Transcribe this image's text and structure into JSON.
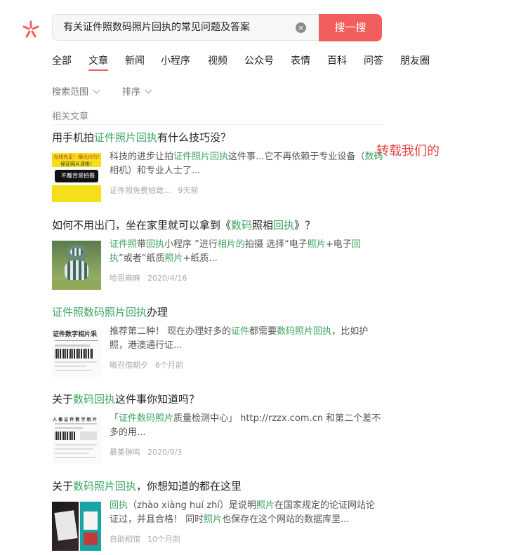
{
  "search": {
    "query": "有关证件照数码照片回执的常见问题及答案",
    "button_label": "搜一搜"
  },
  "tabs": [
    {
      "label": "全部"
    },
    {
      "label": "文章",
      "active": true
    },
    {
      "label": "新闻"
    },
    {
      "label": "小程序"
    },
    {
      "label": "视频"
    },
    {
      "label": "公众号"
    },
    {
      "label": "表情"
    },
    {
      "label": "百科"
    },
    {
      "label": "问答"
    },
    {
      "label": "朋友圈"
    }
  ],
  "filters": {
    "range_label": "搜索范围",
    "sort_label": "排序"
  },
  "section_label": "相关文章",
  "watermark": "转载我们的",
  "results": [
    {
      "title": [
        "用手机拍",
        "证件照片回执",
        "有什么技巧没？"
      ],
      "snippet": [
        "科技的进步让拍",
        "证件照片回执",
        "这件事...它不再依赖于专业设备（",
        "数码",
        "相机）和专业人士了..."
      ],
      "source": "证件照免费拍敢...",
      "time": "9天前",
      "thumb_text_1": "光线充足！横光均匀！",
      "thumb_text_2": "保证照片清晰！",
      "thumb_text_3": "不戴背景拍摄"
    },
    {
      "title": [
        "如何不用出门，坐在家里就可以拿到《",
        "数码",
        "照相",
        "回执",
        "》？"
      ],
      "snippet": [
        "证件照",
        "带",
        "回执",
        "小程序 ”进行",
        "相片的",
        "拍摄 选择“电子",
        "照片",
        "+电子",
        "回执",
        "”或者“纸质",
        "照片",
        "+纸质..."
      ],
      "source": "哈哥麻麻",
      "time": "2020/4/16"
    },
    {
      "title": [
        "证件照数码照片回执",
        "办理"
      ],
      "snippet": [
        "推荐第二种！ 现在办理好多的",
        "证件",
        "都需要",
        "数码照片回执",
        "，比如护照，港澳通行证..."
      ],
      "source": "曦召借朝夕",
      "time": "6个月前",
      "thumb_text_1": "证件数字相片采"
    },
    {
      "title": [
        "关于",
        "数码回执",
        "这件事你知道吗？"
      ],
      "snippet": [
        "「",
        "证件数码照片",
        "质量检测中心」 http://rzzx.com.cn 和第二个差不多的用..."
      ],
      "source": "最美翀鸣",
      "time": "2020/9/3",
      "thumb_text_1": "人 像 证 件 数 字 相 片"
    },
    {
      "title": [
        "关于",
        "数码照片回执",
        "，你想知道的都在这里"
      ],
      "snippet": [
        "回执",
        "（zhào xiàng huí zhí）是说明",
        "照片",
        "在国家规定的论证网站论证过，并且合格！ 同时",
        "照片",
        "也保存在这个网站的数据库里..."
      ],
      "source": "自助相馆",
      "time": "10个月前"
    }
  ]
}
